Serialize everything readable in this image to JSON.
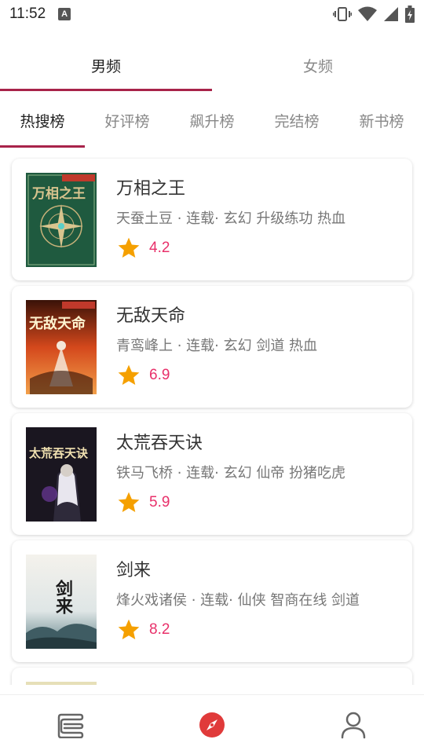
{
  "status_bar": {
    "time": "11:52",
    "notification_letter": "A"
  },
  "gender_tabs": [
    {
      "label": "男频",
      "active": true
    },
    {
      "label": "女频",
      "active": false
    }
  ],
  "rank_tabs": [
    {
      "label": "热搜榜",
      "active": true
    },
    {
      "label": "好评榜",
      "active": false
    },
    {
      "label": "飙升榜",
      "active": false
    },
    {
      "label": "完结榜",
      "active": false
    },
    {
      "label": "新书榜",
      "active": false
    }
  ],
  "books": [
    {
      "title": "万相之王",
      "meta": "天蚕土豆 · 连载· 玄幻 升级练功 热血",
      "rating": "4.2",
      "cover_text": "万相之王",
      "cover_icon": "compass-emblem"
    },
    {
      "title": "无敌天命",
      "meta": "青鸾峰上 · 连载· 玄幻 剑道 热血",
      "rating": "6.9",
      "cover_text": "无敌天命",
      "cover_icon": "flame-swordsman"
    },
    {
      "title": "太荒吞天诀",
      "meta": "铁马飞桥 · 连载· 玄幻 仙帝 扮猪吃虎",
      "rating": "5.9",
      "cover_text": "太荒吞天诀",
      "cover_icon": "white-hair-warrior"
    },
    {
      "title": "剑来",
      "meta": "烽火戏诸侯 · 连载· 仙侠 智商在线 剑道",
      "rating": "8.2",
      "cover_text": "剑来",
      "cover_icon": "ink-landscape"
    },
    {
      "title": "",
      "meta": "",
      "rating": "",
      "cover_text": "",
      "cover_icon": "partial-cover"
    }
  ],
  "bottom_nav": [
    {
      "icon": "bookshelf-icon",
      "active": false
    },
    {
      "icon": "compass-icon",
      "active": true
    },
    {
      "icon": "profile-icon",
      "active": false
    }
  ],
  "colors": {
    "accent": "#a8234a",
    "rating": "#e8306a",
    "star": "#f5a000",
    "compass": "#e03a3a"
  }
}
